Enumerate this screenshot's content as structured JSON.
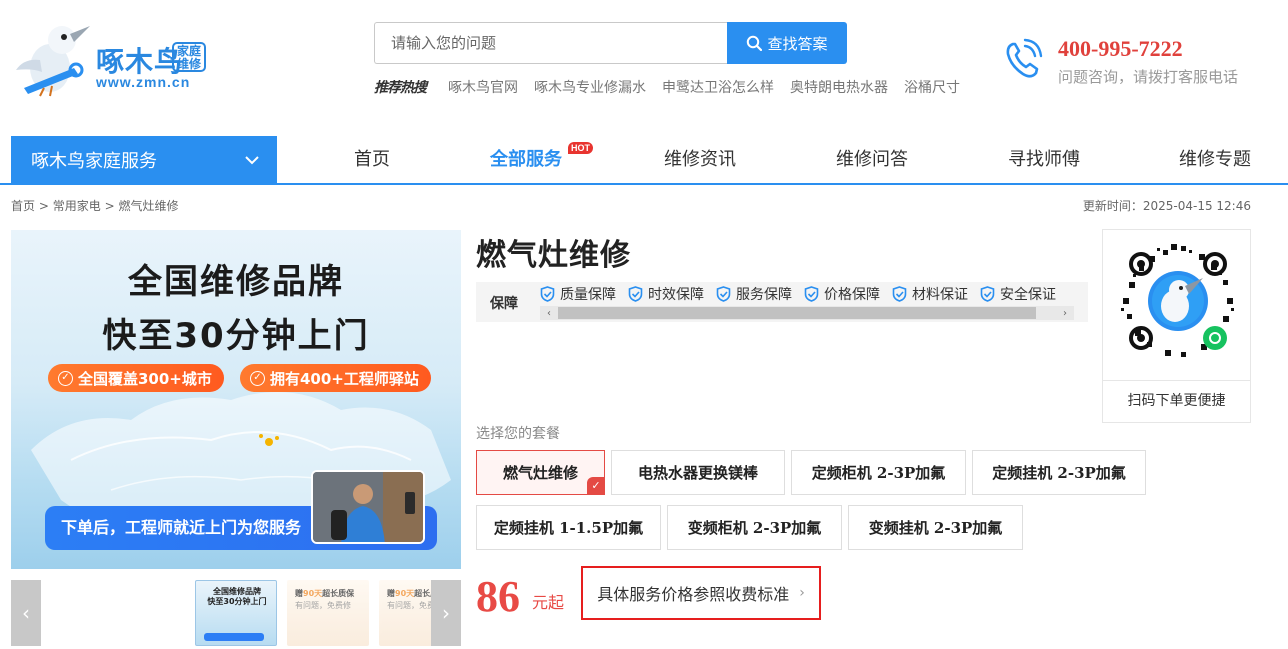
{
  "header": {
    "logo_name": "啄木鸟",
    "logo_badge": "家庭\n维修",
    "logo_domain": "www.zmn.cn",
    "search": {
      "placeholder": "请输入您的问题",
      "button_label": "查找答案"
    },
    "hot_search": {
      "label": "推荐热搜",
      "links": [
        "啄木鸟官网",
        "啄木鸟专业修漏水",
        "申鹭达卫浴怎么样",
        "奥特朗电热水器",
        "浴桶尺寸"
      ]
    },
    "phone": {
      "number": "400-995-7222",
      "tip": "问题咨询，请拨打客服电话"
    }
  },
  "nav": {
    "category_label": "啄木鸟家庭服务",
    "items": [
      {
        "label": "首页",
        "active": false
      },
      {
        "label": "全部服务",
        "active": true,
        "badge": "HOT"
      },
      {
        "label": "维修资讯",
        "active": false
      },
      {
        "label": "维修问答",
        "active": false
      },
      {
        "label": "寻找师傅",
        "active": false
      },
      {
        "label": "维修专题",
        "active": false
      }
    ]
  },
  "breadcrumb": {
    "items": [
      "首页",
      "常用家电",
      "燃气灶维修"
    ],
    "separator": ">",
    "update_time": "更新时间：2025-04-15 12:46"
  },
  "banner": {
    "line1": "全国维修品牌",
    "line2": "快至30分钟上门",
    "pill1": "全国覆盖300+城市",
    "pill2": "拥有400+工程师驿站",
    "bottom_text": "下单后，工程师就近上门为您服务"
  },
  "thumbnails": {
    "thumb1_line1": "全国维修品牌",
    "thumb1_line2": "快至30分钟上门",
    "thumb2_prefix": "赠",
    "thumb2_highlight": "90天",
    "thumb2_suffix": "超长质保",
    "thumb2_sub": "有问题，免费修",
    "thumb3_prefix": "赠",
    "thumb3_highlight": "90天",
    "thumb3_suffix": "超长质保",
    "thumb3_sub": "有问题，免费修"
  },
  "product": {
    "title": "燃气灶维修",
    "guarantee_label": "保障",
    "guarantees": [
      "质量保障",
      "时效保障",
      "服务保障",
      "价格保障",
      "材料保证",
      "安全保证"
    ],
    "qr_caption": "扫码下单更便捷",
    "package_label": "选择您的套餐",
    "packages": [
      {
        "label": "燃气灶维修",
        "selected": true
      },
      {
        "label": "电热水器更换镁棒",
        "selected": false
      },
      {
        "label": "定频柜机 2-3P加氟",
        "selected": false
      },
      {
        "label": "定频挂机 2-3P加氟",
        "selected": false
      },
      {
        "label": "定频挂机 1-1.5P加氟",
        "selected": false
      },
      {
        "label": "变频柜机 2-3P加氟",
        "selected": false
      },
      {
        "label": "变频挂机 2-3P加氟",
        "selected": false
      }
    ],
    "price": "86",
    "price_unit": "元起",
    "price_standard": "具体服务价格参照收费标准"
  },
  "colors": {
    "brand_blue": "#2a8ff0",
    "price_red": "#e84a45",
    "phone_red": "#e0413c",
    "highlight_border": "#e61e1e"
  },
  "icons": {
    "search": "search-icon",
    "phone": "phone-icon",
    "chevron": "chevron-down-icon",
    "shield": "shield-check-icon",
    "check": "check-icon",
    "arrow_left": "arrow-left-icon",
    "arrow_right": "arrow-right-icon"
  }
}
